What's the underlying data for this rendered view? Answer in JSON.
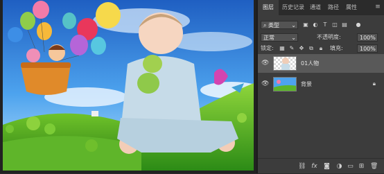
{
  "tabs": [
    {
      "label": "图层"
    },
    {
      "label": "历史记录"
    },
    {
      "label": "通道"
    },
    {
      "label": "路径"
    },
    {
      "label": "属性"
    }
  ],
  "filter": {
    "kind": "类型"
  },
  "blend": {
    "mode": "正常",
    "opacity_label": "不透明度:",
    "opacity_value": "100%"
  },
  "lock": {
    "label": "锁定:",
    "fill_label": "填充:",
    "fill_value": "100%"
  },
  "layers": [
    {
      "name": "01人物",
      "selected": true,
      "locked": false
    },
    {
      "name": "背景",
      "selected": false,
      "locked": true
    }
  ],
  "colors": {
    "panel": "#3c3c3c",
    "tab_bar": "#2b2b2b",
    "selected_row": "#595959"
  }
}
